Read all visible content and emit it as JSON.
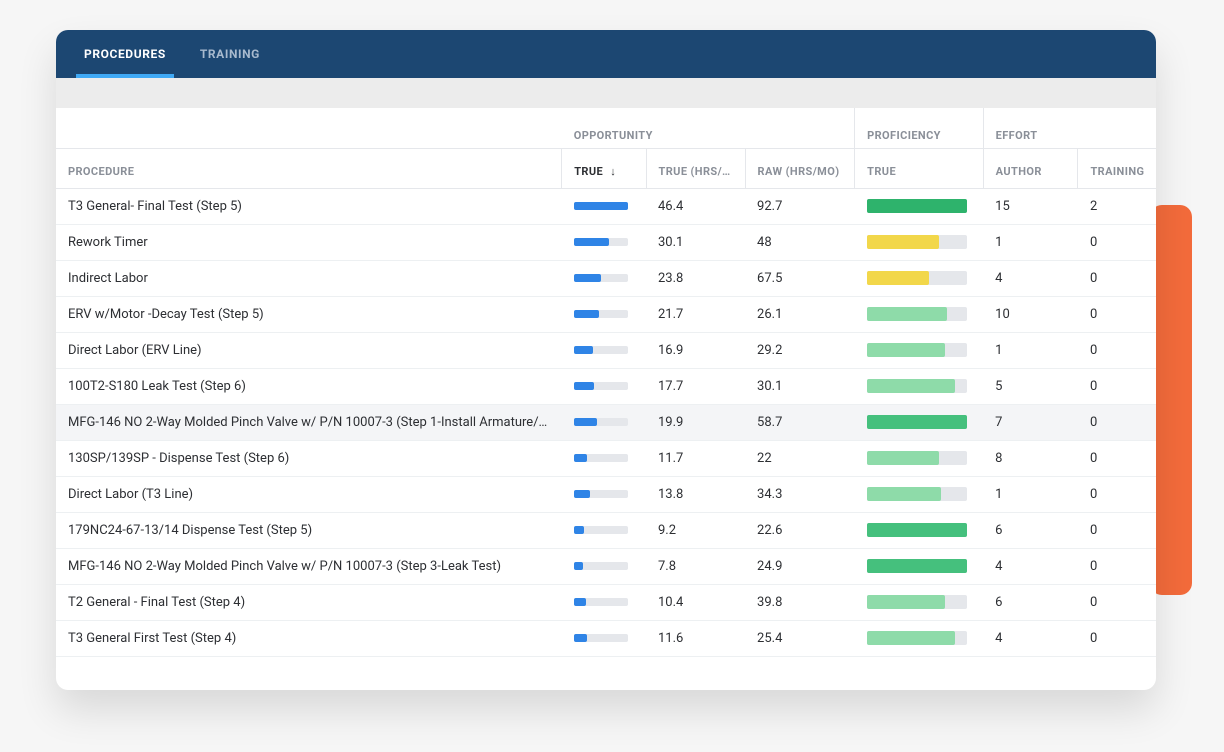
{
  "tabs": {
    "procedures": "Procedures",
    "training": "Training",
    "active": "procedures"
  },
  "headers": {
    "procedure": "Procedure",
    "opportunity": "Opportunity",
    "proficiency": "Proficiency",
    "effort": "Effort",
    "true": "True",
    "true_hrs": "True (hrs/…",
    "raw_hrs": "Raw (hrs/mo)",
    "prof_true": "True",
    "author": "Author",
    "training": "Training",
    "sort_arrow": "↓"
  },
  "colors": {
    "blue": "#2f84e6",
    "green_deep": "#2eb36c",
    "green_mid": "#45c07d",
    "green_light": "#8edba9",
    "yellow": "#f2d74a"
  },
  "maxTrueBar": 46.4,
  "rows": [
    {
      "name": "T3 General- Final Test (Step 5)",
      "trueBar": 46.4,
      "trueHrs": "46.4",
      "rawHrs": "92.7",
      "profPct": 100,
      "profColor": "green_deep",
      "author": "15",
      "training": "2"
    },
    {
      "name": "Rework Timer",
      "trueBar": 30.1,
      "trueHrs": "30.1",
      "rawHrs": "48",
      "profPct": 72,
      "profColor": "yellow",
      "author": "1",
      "training": "0"
    },
    {
      "name": "Indirect Labor",
      "trueBar": 23.8,
      "trueHrs": "23.8",
      "rawHrs": "67.5",
      "profPct": 62,
      "profColor": "yellow",
      "author": "4",
      "training": "0"
    },
    {
      "name": "ERV w/Motor -Decay Test (Step 5)",
      "trueBar": 21.7,
      "trueHrs": "21.7",
      "rawHrs": "26.1",
      "profPct": 80,
      "profColor": "green_light",
      "author": "10",
      "training": "0"
    },
    {
      "name": "Direct Labor (ERV Line)",
      "trueBar": 16.9,
      "trueHrs": "16.9",
      "rawHrs": "29.2",
      "profPct": 78,
      "profColor": "green_light",
      "author": "1",
      "training": "0"
    },
    {
      "name": "100T2-S180 Leak Test (Step 6)",
      "trueBar": 17.7,
      "trueHrs": "17.7",
      "rawHrs": "30.1",
      "profPct": 88,
      "profColor": "green_light",
      "author": "5",
      "training": "0"
    },
    {
      "name": "MFG-146 NO 2-Way Molded Pinch Valve w/ P/N 10007-3 (Step 1-Install Armature/…",
      "trueBar": 19.9,
      "trueHrs": "19.9",
      "rawHrs": "58.7",
      "profPct": 100,
      "profColor": "green_mid",
      "author": "7",
      "training": "0",
      "hovered": true
    },
    {
      "name": "130SP/139SP - Dispense Test (Step 6)",
      "trueBar": 11.7,
      "trueHrs": "11.7",
      "rawHrs": "22",
      "profPct": 72,
      "profColor": "green_light",
      "author": "8",
      "training": "0"
    },
    {
      "name": "Direct Labor (T3 Line)",
      "trueBar": 13.8,
      "trueHrs": "13.8",
      "rawHrs": "34.3",
      "profPct": 74,
      "profColor": "green_light",
      "author": "1",
      "training": "0"
    },
    {
      "name": "179NC24-67-13/14 Dispense Test (Step 5)",
      "trueBar": 9.2,
      "trueHrs": "9.2",
      "rawHrs": "22.6",
      "profPct": 100,
      "profColor": "green_mid",
      "author": "6",
      "training": "0"
    },
    {
      "name": "MFG-146 NO 2-Way Molded Pinch Valve w/ P/N 10007-3 (Step 3-Leak Test)",
      "trueBar": 7.8,
      "trueHrs": "7.8",
      "rawHrs": "24.9",
      "profPct": 100,
      "profColor": "green_mid",
      "author": "4",
      "training": "0"
    },
    {
      "name": "T2 General - Final Test (Step 4)",
      "trueBar": 10.4,
      "trueHrs": "10.4",
      "rawHrs": "39.8",
      "profPct": 78,
      "profColor": "green_light",
      "author": "6",
      "training": "0"
    },
    {
      "name": "T3 General First Test (Step 4)",
      "trueBar": 11.6,
      "trueHrs": "11.6",
      "rawHrs": "25.4",
      "profPct": 88,
      "profColor": "green_light",
      "author": "4",
      "training": "0"
    }
  ]
}
